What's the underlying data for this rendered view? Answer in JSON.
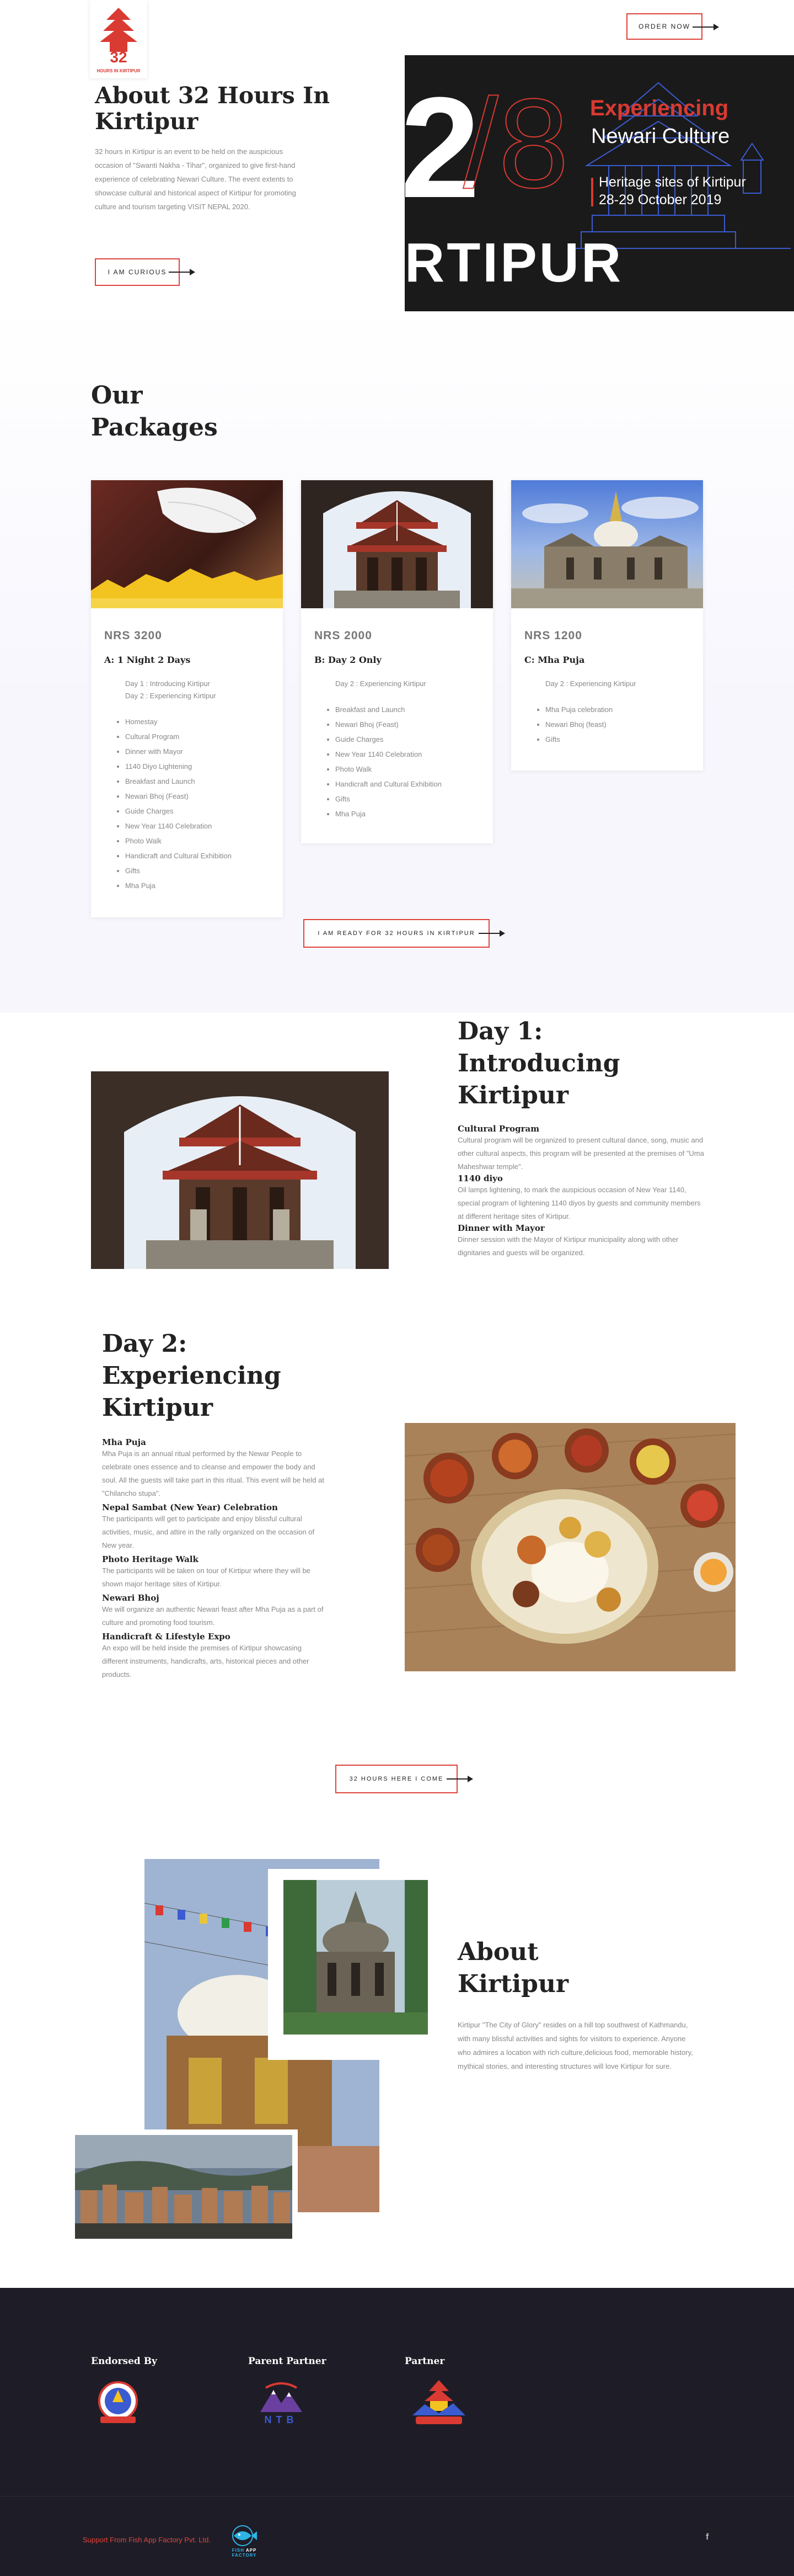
{
  "header": {
    "order_now": "ORDER NOW",
    "logo_number": "32",
    "logo_caption": "HOURS IN KIRTIPUR"
  },
  "hero": {
    "title_line1": "About 32 Hours In",
    "title_line2": "Kirtipur",
    "description": "32 hours in Kirtipur is an event to be held on the auspicious occasion of \"Swanti Nakha - Tihar\", organized to give first-hand experience of celebrating Newari Culture. The event extents to showcase cultural and historical aspect of Kirtipur for promoting culture and tourism targeting VISIT NEPAL 2020.",
    "cta": "I AM CURIOUS"
  },
  "banner": {
    "big_number": "2",
    "outline_text": "/8",
    "kirtipur": "RTIPUR",
    "experiencing": "Experiencing",
    "newari": "Newari Culture",
    "heritage": "Heritage sites of Kirtipur",
    "dates": "28-29 October 2019"
  },
  "packages": {
    "heading_line1": "Our",
    "heading_line2": "Packages",
    "cta": "I AM READY FOR 32 HOURS IN KIRTIPUR",
    "items": [
      {
        "price": "NRS 3200",
        "name": "A: 1 Night 2 Days",
        "days": [
          "Day 1 : Introducing Kirtipur",
          "Day 2 : Experiencing Kirtipur"
        ],
        "features": [
          "Homestay",
          "Cultural Program",
          "Dinner with Mayor",
          "1140 Diyo Lightening",
          "Breakfast and Launch",
          "Newari Bhoj (Feast)",
          "Guide Charges",
          "New Year 1140 Celebration",
          "Photo Walk",
          "Handicraft and Cultural Exhibition",
          "Gifts",
          "Mha Puja"
        ]
      },
      {
        "price": "NRS 2000",
        "name": "B: Day 2 Only",
        "days": [
          "Day 2 : Experiencing Kirtipur"
        ],
        "features": [
          "Breakfast and Launch",
          "Newari Bhoj (Feast)",
          "Guide Charges",
          "New Year 1140 Celebration",
          "Photo Walk",
          "Handicraft and Cultural Exhibition",
          "Gifts",
          "Mha Puja"
        ]
      },
      {
        "price": "NRS 1200",
        "name": "C: Mha Puja",
        "days": [
          "Day 2 : Experiencing Kirtipur"
        ],
        "features": [
          "Mha Puja celebration",
          "Newari Bhoj (feast)",
          "Gifts"
        ]
      }
    ]
  },
  "day1": {
    "heading_line1": "Day 1:",
    "heading_line2": "Introducing",
    "heading_line3": "Kirtipur",
    "items": [
      {
        "title": "Cultural Program",
        "text": "Cultural program will be organized to present cultural dance, song, music and other cultural aspects, this program will be presented at the premises of \"Uma Maheshwar temple\"."
      },
      {
        "title": "1140 diyo",
        "text": "Oil lamps lightening, to mark the auspicious occasion of New Year 1140, special program of lightening 1140 diyos by guests and community members at different heritage sites of Kirtipur."
      },
      {
        "title": "Dinner with Mayor",
        "text": "Dinner session with the Mayor of Kirtipur municipality along with other dignitaries and guests will be organized."
      }
    ]
  },
  "day2": {
    "heading_line1": "Day 2:",
    "heading_line2": "Experiencing",
    "heading_line3": "Kirtipur",
    "cta": "32 HOURS HERE I COME",
    "items": [
      {
        "title": "Mha Puja",
        "text": "Mha Puja is an annual ritual performed by the Newar People to celebrate ones essence and to cleanse and empower the body and soul. All the guests will take part in this ritual. This event will be held at \"Chilancho stupa\"."
      },
      {
        "title": "Nepal Sambat (New Year) Celebration",
        "text": "The participants will get to participate and enjoy blissful cultural activities, music, and attire in the rally organized on the occasion of New year."
      },
      {
        "title": "Photo Heritage Walk",
        "text": "The participants will be taken on tour of Kirtipur where they will be shown major heritage sites of Kirtipur."
      },
      {
        "title": "Newari Bhoj",
        "text": "We will organize an authentic Newari feast after Mha Puja as a part of culture and promoting food tourism."
      },
      {
        "title": "Handicraft & Lifestyle Expo",
        "text": "An expo will be held inside the premises of Kirtipur showcasing different instruments, handicrafts, arts, historical pieces and other products."
      }
    ]
  },
  "about": {
    "heading_line1": "About",
    "heading_line2": "Kirtipur",
    "text": "Kirtipur \"The City of Glory\" resides on a hill top southwest of Kathmandu, with many blissful activities and sights for visitors to experience. Anyone who admires a location with rich culture,delicious food, memorable history, mythical stories, and interesting structures will love Kirtipur for sure."
  },
  "partners": {
    "endorsed": "Endorsed By",
    "parent": "Parent Partner",
    "partner": "Partner",
    "ntb_label": "NTB"
  },
  "footer": {
    "support": "Support From Fish App Factory Pvt. Ltd.",
    "brand_a": "FISH",
    "brand_b": "APP",
    "brand_c": "FACTORY",
    "social": "f"
  },
  "colors": {
    "accent": "#e0433b",
    "dark": "#1e1d27",
    "banner": "#1a1a1a",
    "blue": "#3b5bd0"
  }
}
